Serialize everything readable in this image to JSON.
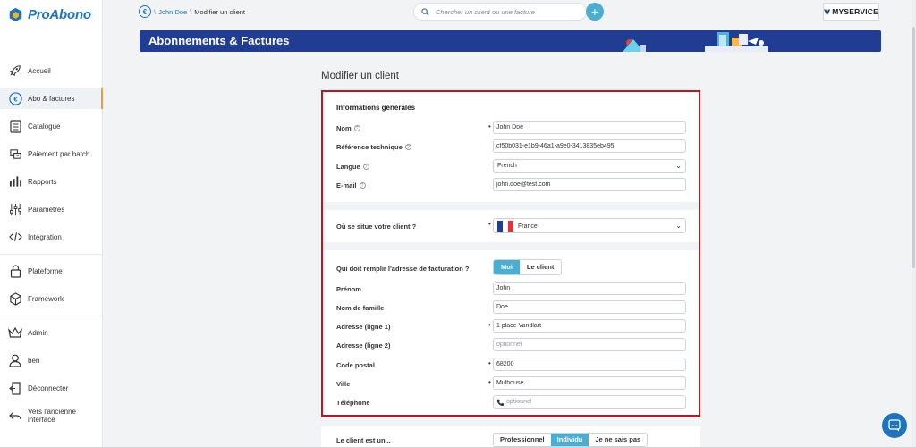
{
  "app": {
    "logo_text": "ProAbono",
    "brand": "MYSERVICE"
  },
  "sidebar": {
    "items": [
      {
        "label": "Accueil"
      },
      {
        "label": "Abo & factures"
      },
      {
        "label": "Catalogue"
      },
      {
        "label": "Paiement par batch"
      },
      {
        "label": "Rapports"
      },
      {
        "label": "Paramètres"
      },
      {
        "label": "Intégration"
      },
      {
        "label": "Plateforme"
      },
      {
        "label": "Framework"
      },
      {
        "label": "Admin"
      },
      {
        "label": "ben"
      },
      {
        "label": "Déconnecter"
      },
      {
        "label": "Vers l'ancienne interface"
      }
    ]
  },
  "breadcrumb": {
    "coin": "€",
    "sep": "\\",
    "link": "John Doe",
    "current": "Modifier un client"
  },
  "search": {
    "placeholder": "Chercher un client ou une facture"
  },
  "banner": {
    "title": "Abonnements & Factures"
  },
  "page": {
    "title": "Modifier un client"
  },
  "general": {
    "title": "Informations générales",
    "nom_label": "Nom",
    "nom_value": "John Doe",
    "ref_label": "Référence technique",
    "ref_value": "cf50b031-e1b9-46a1-a9e0-3413835eb495",
    "langue_label": "Langue",
    "langue_value": "French",
    "email_label": "E-mail",
    "email_value": "john.doe@test.com"
  },
  "location": {
    "label": "Où se situe votre client ?",
    "value": "France"
  },
  "billing": {
    "question": "Qui doit remplir l'adresse de facturation ?",
    "opt_me": "Moi",
    "opt_client": "Le client",
    "prenom_label": "Prénom",
    "prenom_value": "John",
    "famille_label": "Nom de famille",
    "famille_value": "Doe",
    "adr1_label": "Adresse (ligne 1)",
    "adr1_value": "1 place Vandlart",
    "adr2_label": "Adresse (ligne 2)",
    "adr2_placeholder": "optionnel",
    "cp_label": "Code postal",
    "cp_value": "68200",
    "ville_label": "Ville",
    "ville_value": "Mulhouse",
    "tel_label": "Téléphone",
    "tel_placeholder": "optionnel"
  },
  "client_type": {
    "label": "Le client est un...",
    "opt_pro": "Professionnel",
    "opt_ind": "Individu",
    "opt_unknown": "Je ne sais pas"
  },
  "colors": {
    "accent": "#4baed1",
    "brand_blue": "#1e73be",
    "banner": "#213c93",
    "highlight_border": "#c4121f"
  }
}
